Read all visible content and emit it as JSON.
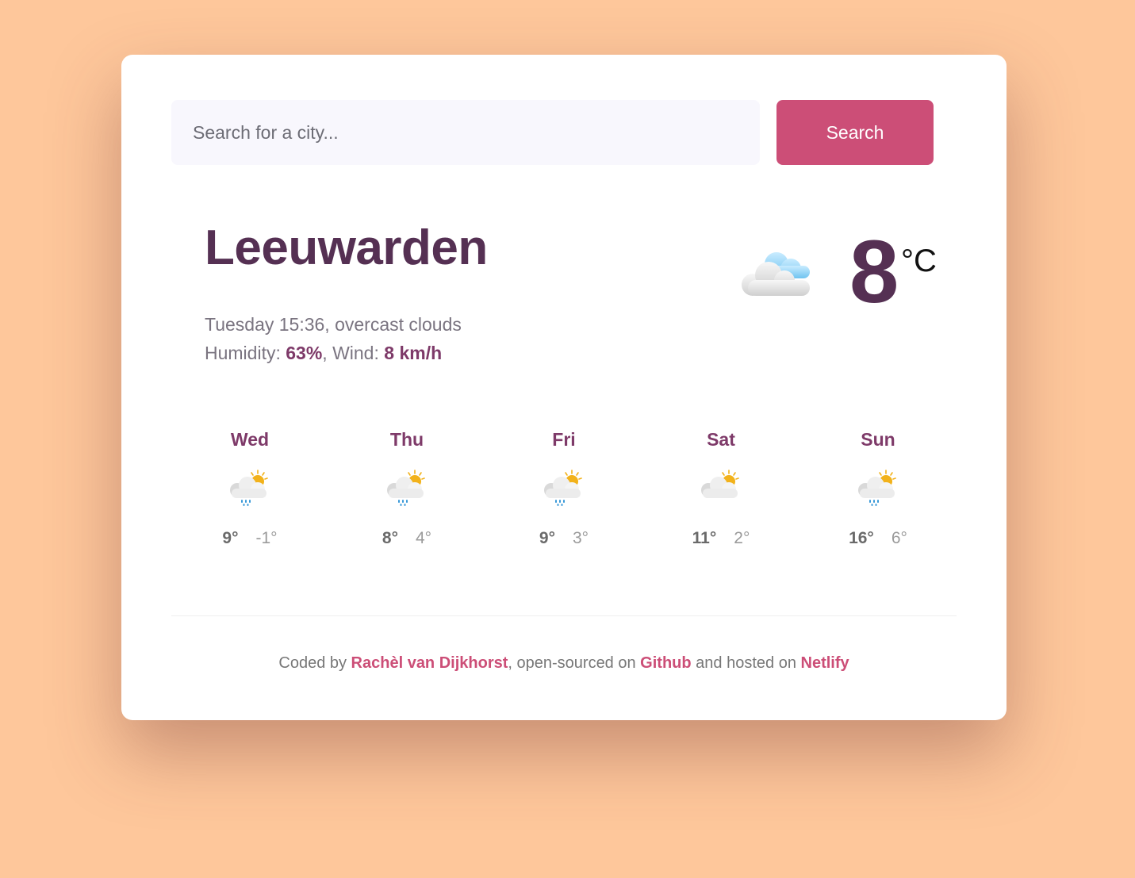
{
  "search": {
    "placeholder": "Search for a city...",
    "button_label": "Search"
  },
  "current": {
    "city": "Leeuwarden",
    "description": "Tuesday 15:36, overcast clouds",
    "humidity_label": "Humidity: ",
    "humidity": "63%",
    "wind_label": ", Wind: ",
    "wind": "8 km/h",
    "temperature": "8",
    "unit": "°C",
    "icon": "overcast-clouds-icon"
  },
  "forecast": [
    {
      "day": "Wed",
      "max": "9°",
      "min": "-1°",
      "icon": "sun-cloud-rain-icon"
    },
    {
      "day": "Thu",
      "max": "8°",
      "min": "4°",
      "icon": "sun-cloud-rain-icon"
    },
    {
      "day": "Fri",
      "max": "9°",
      "min": "3°",
      "icon": "sun-cloud-rain-icon"
    },
    {
      "day": "Sat",
      "max": "11°",
      "min": "2°",
      "icon": "sun-cloud-icon"
    },
    {
      "day": "Sun",
      "max": "16°",
      "min": "6°",
      "icon": "sun-cloud-rain-icon"
    }
  ],
  "footer": {
    "prefix": "Coded by ",
    "author": "Rachèl van Dijkhorst",
    "middle": ", open-sourced on ",
    "repo": "Github",
    "middle2": " and hosted on ",
    "host": "Netlify"
  },
  "colors": {
    "background": "#fec79b",
    "accent": "#cc4e77",
    "heading": "#553053",
    "highlight": "#7e3a69"
  }
}
